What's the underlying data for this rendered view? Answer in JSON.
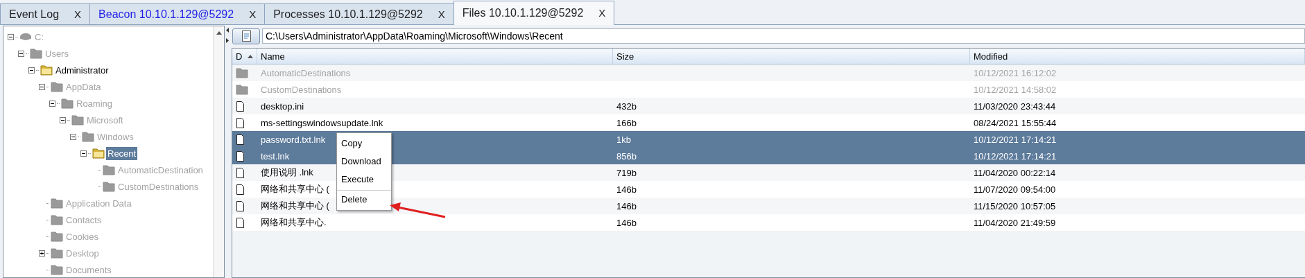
{
  "tabs": [
    {
      "label": "Event Log",
      "close": "X",
      "selected": false,
      "highlighted": false
    },
    {
      "label": "Beacon 10.10.1.129@5292",
      "close": "X",
      "selected": false,
      "highlighted": true
    },
    {
      "label": "Processes 10.10.1.129@5292",
      "close": "X",
      "selected": false,
      "highlighted": false
    },
    {
      "label": "Files 10.10.1.129@5292",
      "close": "X",
      "selected": true,
      "highlighted": false
    }
  ],
  "tree": {
    "items": [
      {
        "label": "C:",
        "kind": "drive",
        "expanded": true,
        "dimmed": true,
        "selected": false,
        "children": [
          {
            "label": "Users",
            "kind": "folder",
            "expanded": true,
            "dimmed": true,
            "selected": false,
            "children": [
              {
                "label": "Administrator",
                "kind": "folder",
                "expanded": true,
                "dimmed": false,
                "selected": false,
                "children": [
                  {
                    "label": "AppData",
                    "kind": "folder",
                    "expanded": true,
                    "dimmed": true,
                    "selected": false,
                    "children": [
                      {
                        "label": "Roaming",
                        "kind": "folder",
                        "expanded": true,
                        "dimmed": true,
                        "selected": false,
                        "children": [
                          {
                            "label": "Microsoft",
                            "kind": "folder",
                            "expanded": true,
                            "dimmed": true,
                            "selected": false,
                            "children": [
                              {
                                "label": "Windows",
                                "kind": "folder",
                                "expanded": true,
                                "dimmed": true,
                                "selected": false,
                                "children": [
                                  {
                                    "label": "Recent",
                                    "kind": "folder",
                                    "expanded": true,
                                    "dimmed": false,
                                    "selected": true,
                                    "children": [
                                      {
                                        "label": "AutomaticDestination",
                                        "kind": "folder",
                                        "dimmed": true,
                                        "selected": false
                                      },
                                      {
                                        "label": "CustomDestinations",
                                        "kind": "folder",
                                        "dimmed": true,
                                        "selected": false
                                      }
                                    ]
                                  }
                                ]
                              }
                            ]
                          }
                        ]
                      }
                    ]
                  },
                  {
                    "label": "Application Data",
                    "kind": "folder",
                    "dimmed": true,
                    "selected": false
                  },
                  {
                    "label": "Contacts",
                    "kind": "folder",
                    "dimmed": true,
                    "selected": false
                  },
                  {
                    "label": "Cookies",
                    "kind": "folder",
                    "dimmed": true,
                    "selected": false
                  },
                  {
                    "label": "Desktop",
                    "kind": "folder",
                    "expanded": false,
                    "dimmed": true,
                    "selected": false
                  },
                  {
                    "label": "Documents",
                    "kind": "folder",
                    "dimmed": true,
                    "selected": false
                  }
                ]
              }
            ]
          }
        ]
      }
    ]
  },
  "path": {
    "value": "C:\\Users\\Administrator\\AppData\\Roaming\\Microsoft\\Windows\\Recent"
  },
  "table": {
    "columns": [
      "D",
      "Name",
      "Size",
      "Modified"
    ],
    "rows": [
      {
        "kind": "folder",
        "name": "AutomaticDestinations",
        "size": "",
        "modified": "10/12/2021 16:12:02",
        "dimmed": true,
        "selected": false
      },
      {
        "kind": "folder",
        "name": "CustomDestinations",
        "size": "",
        "modified": "10/12/2021 14:58:02",
        "dimmed": true,
        "selected": false
      },
      {
        "kind": "file",
        "name": "desktop.ini",
        "size": "432b",
        "modified": "11/03/2020 23:43:44",
        "dimmed": false,
        "selected": false
      },
      {
        "kind": "file",
        "name": "ms-settingswindowsupdate.lnk",
        "size": "166b",
        "modified": "08/24/2021 15:55:44",
        "dimmed": false,
        "selected": false
      },
      {
        "kind": "file",
        "name": "password.txt.lnk",
        "size": "1kb",
        "modified": "10/12/2021 17:14:21",
        "dimmed": false,
        "selected": true
      },
      {
        "kind": "file",
        "name": "test.lnk",
        "size": "856b",
        "modified": "10/12/2021 17:14:21",
        "dimmed": false,
        "selected": true
      },
      {
        "kind": "file",
        "name": "使用说明 .lnk",
        "size": "719b",
        "modified": "11/04/2020 00:22:14",
        "dimmed": false,
        "selected": false
      },
      {
        "kind": "file",
        "name": "网络和共享中心 (",
        "size": "146b",
        "modified": "11/07/2020 09:54:00",
        "dimmed": false,
        "selected": false
      },
      {
        "kind": "file",
        "name": "网络和共享中心 (",
        "size": "146b",
        "modified": "11/15/2020 10:57:05",
        "dimmed": false,
        "selected": false
      },
      {
        "kind": "file",
        "name": "网络和共享中心.",
        "size": "146b",
        "modified": "11/04/2020 21:49:59",
        "dimmed": false,
        "selected": false
      }
    ]
  },
  "context_menu": {
    "items": [
      {
        "label": "Copy",
        "separator_before": false
      },
      {
        "label": "Download",
        "separator_before": false
      },
      {
        "label": "Execute",
        "separator_before": false
      },
      {
        "label": "Delete",
        "separator_before": true
      }
    ]
  }
}
